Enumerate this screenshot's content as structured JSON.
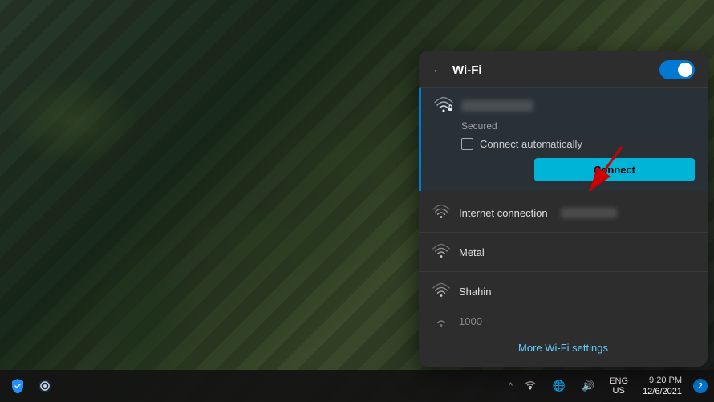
{
  "desktop": {
    "bg_description": "dark green leaf texture"
  },
  "wifi_panel": {
    "title": "Wi-Fi",
    "back_label": "←",
    "toggle_on": true,
    "active_network": {
      "status": "Secured",
      "connect_auto_label": "Connect automatically",
      "connect_btn_label": "Connect"
    },
    "networks": [
      {
        "name": "Internet connection",
        "has_blur": true,
        "blur_label": ""
      },
      {
        "name": "Metal",
        "has_blur": false,
        "blur_label": ""
      },
      {
        "name": "Shahin",
        "has_blur": false,
        "blur_label": ""
      },
      {
        "name": "1000",
        "partial": true,
        "has_blur": false
      }
    ],
    "more_settings_label": "More Wi-Fi settings"
  },
  "taskbar": {
    "shield_icon": "shield",
    "steam_icon": "steam",
    "tray_arrow": "^",
    "globe_icon": "🌐",
    "volume_icon": "🔊",
    "lang": "ENG",
    "region": "US",
    "time": "9:20 PM",
    "date": "12/6/2021",
    "notification_count": "2"
  }
}
